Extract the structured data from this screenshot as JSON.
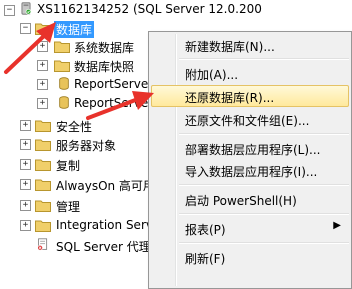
{
  "tree": {
    "server": "XS1162134252 (SQL Server 12.0.200",
    "databases_node": "数据库",
    "databases_children": [
      "系统数据库",
      "数据库快照",
      "ReportServer",
      "ReportServer"
    ],
    "other_nodes": [
      "安全性",
      "服务器对象",
      "复制",
      "AlwaysOn 高可用",
      "管理",
      "Integration Serv"
    ],
    "agent": "SQL Server 代理"
  },
  "context_menu": {
    "items": [
      {
        "label": "新建数据库(N)..."
      },
      {
        "label": "附加(A)..."
      },
      {
        "label": "还原数据库(R)...",
        "highlighted": true
      },
      {
        "label": "还原文件和文件组(E)..."
      },
      {
        "label": "部署数据层应用程序(L)..."
      },
      {
        "label": "导入数据层应用程序(I)..."
      },
      {
        "label": "启动 PowerShell(H)"
      },
      {
        "label": "报表(P)",
        "submenu": true
      },
      {
        "label": "刷新(F)"
      }
    ],
    "submenu_arrow": "▶"
  },
  "colors": {
    "selection": "#3399ff",
    "highlight": "#ffe99c",
    "annotation_arrow": "#e8322b",
    "folder": "#e8c35a"
  },
  "icons": {
    "expand": "⊞",
    "collapse": "⊟"
  }
}
